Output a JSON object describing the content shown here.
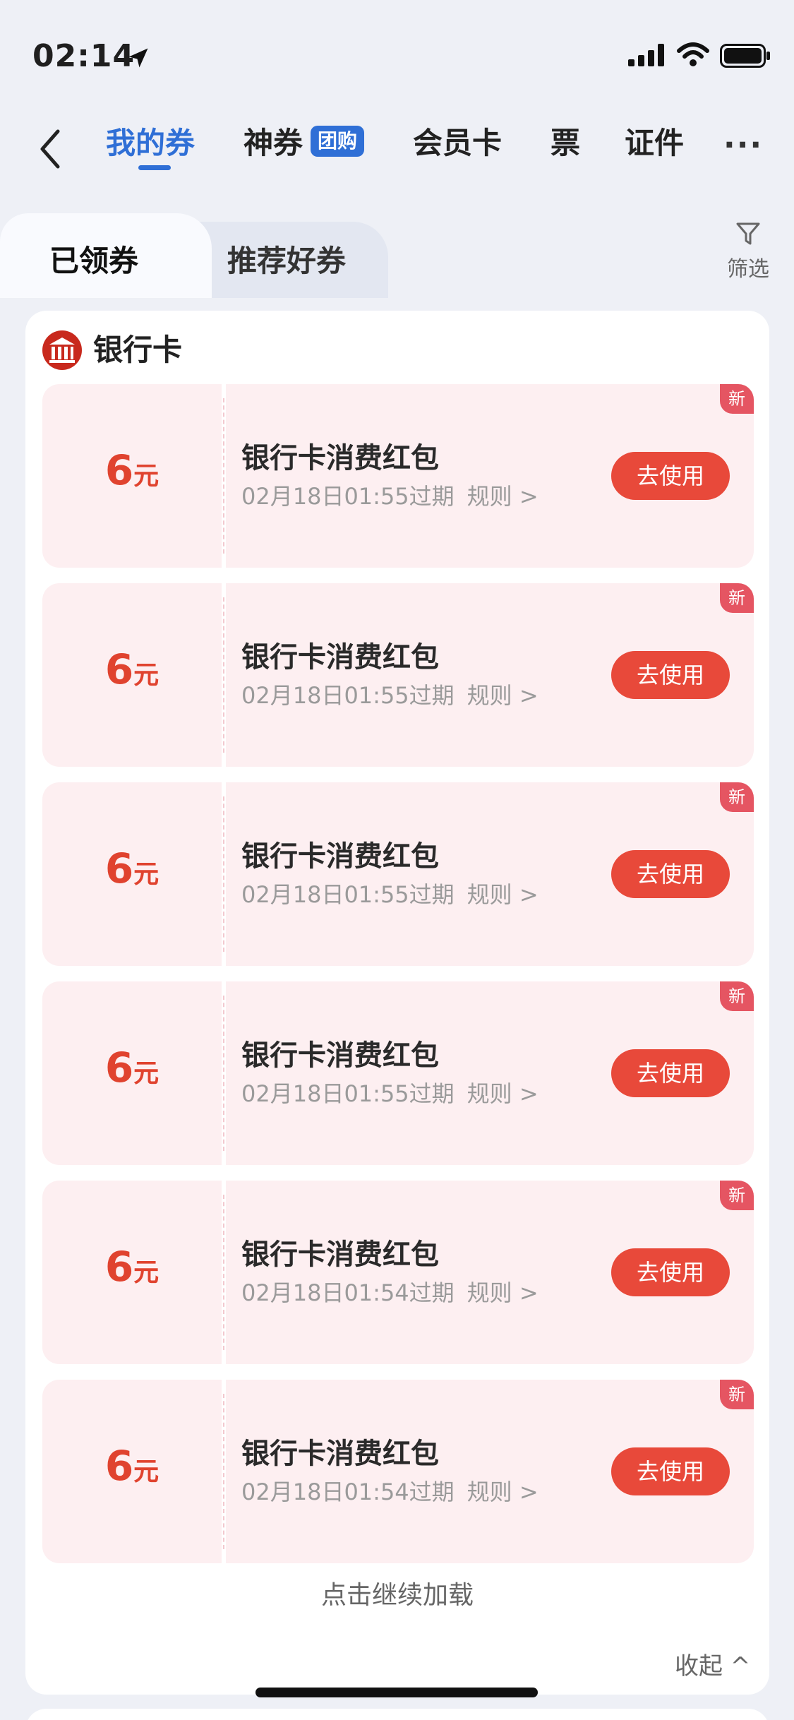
{
  "status_bar": {
    "time": "02:14"
  },
  "nav": {
    "tabs": [
      {
        "label": "我的券"
      },
      {
        "label": "神券"
      },
      {
        "label": "会员卡"
      },
      {
        "label": "票"
      },
      {
        "label": "证件"
      }
    ],
    "badge": "团购",
    "more": "···"
  },
  "subtabs": {
    "claimed": "已领券",
    "recommended": "推荐好券",
    "filter": "筛选"
  },
  "section": {
    "title": "银行卡"
  },
  "coupons": [
    {
      "amount": "6",
      "unit": "元",
      "title": "银行卡消费红包",
      "expiry": "02月18日01:55过期",
      "rule": "规则 >",
      "action": "去使用",
      "badge": "新"
    },
    {
      "amount": "6",
      "unit": "元",
      "title": "银行卡消费红包",
      "expiry": "02月18日01:55过期",
      "rule": "规则 >",
      "action": "去使用",
      "badge": "新"
    },
    {
      "amount": "6",
      "unit": "元",
      "title": "银行卡消费红包",
      "expiry": "02月18日01:55过期",
      "rule": "规则 >",
      "action": "去使用",
      "badge": "新"
    },
    {
      "amount": "6",
      "unit": "元",
      "title": "银行卡消费红包",
      "expiry": "02月18日01:55过期",
      "rule": "规则 >",
      "action": "去使用",
      "badge": "新"
    },
    {
      "amount": "6",
      "unit": "元",
      "title": "银行卡消费红包",
      "expiry": "02月18日01:54过期",
      "rule": "规则 >",
      "action": "去使用",
      "badge": "新"
    },
    {
      "amount": "6",
      "unit": "元",
      "title": "银行卡消费红包",
      "expiry": "02月18日01:54过期",
      "rule": "规则 >",
      "action": "去使用",
      "badge": "新"
    }
  ],
  "footer": {
    "load_more": "点击继续加载",
    "collapse": "收起 ^"
  },
  "colors": {
    "accent": "#2f6fd6",
    "coupon_red": "#e8493a",
    "coupon_bg": "#fdeff1"
  }
}
